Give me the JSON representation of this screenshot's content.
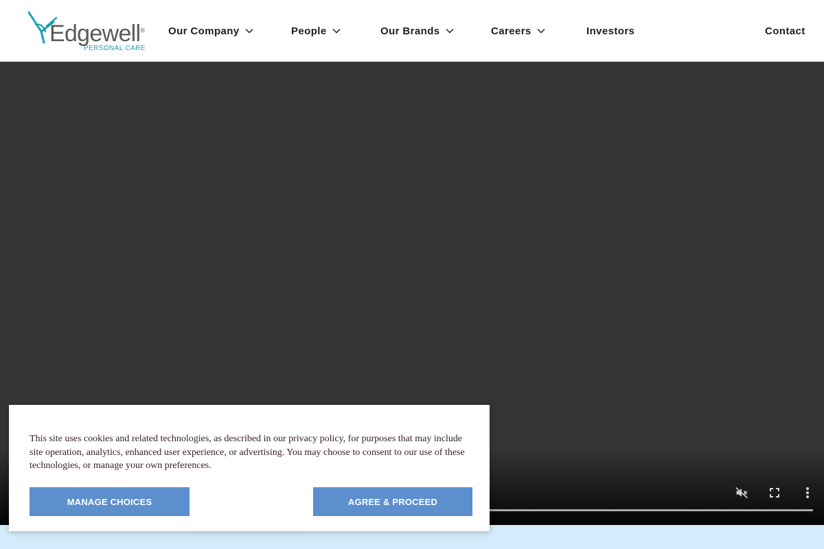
{
  "logo": {
    "word": "Edgewell",
    "reg_mark": "®",
    "tagline": "PERSONAL CARE"
  },
  "nav": [
    {
      "label": "Our Company",
      "has_dropdown": true
    },
    {
      "label": "People",
      "has_dropdown": true
    },
    {
      "label": "Our Brands",
      "has_dropdown": true
    },
    {
      "label": "Careers",
      "has_dropdown": true
    },
    {
      "label": "Investors",
      "has_dropdown": false
    },
    {
      "label": "Contact",
      "has_dropdown": false
    }
  ],
  "video": {
    "controls": [
      "mute-icon",
      "fullscreen-icon",
      "more-options-icon"
    ]
  },
  "cookie": {
    "text": "This site uses cookies and related technologies, as described in our privacy policy, for purposes that may include site operation, analytics, enhanced user experience, or advertising. You may choose to consent to our use of these technologies, or manage your own preferences.",
    "manage_label": "MANAGE CHOICES",
    "agree_label": "AGREE & PROCEED"
  },
  "colors": {
    "brand_teal": "#17a0b3",
    "logo_gray": "#5a5a5a",
    "button_blue": "#5b8fcd",
    "video_bg": "#343434",
    "band_blue": "#d3ecfb"
  }
}
